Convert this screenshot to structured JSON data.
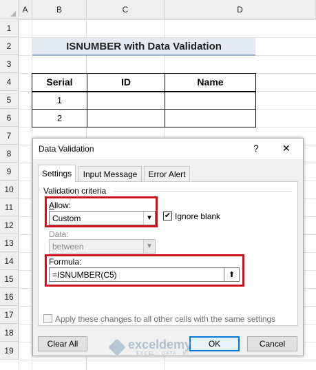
{
  "columns": [
    "A",
    "B",
    "C",
    "D"
  ],
  "rows": [
    "1",
    "2",
    "3",
    "4",
    "5",
    "6",
    "7",
    "8",
    "9",
    "10",
    "11",
    "12",
    "13",
    "14",
    "15",
    "16",
    "17",
    "18",
    "19"
  ],
  "sheet_title": "ISNUMBER with Data Validation",
  "table": {
    "headers": [
      "Serial",
      "ID",
      "Name"
    ],
    "rows": [
      [
        "1",
        "",
        ""
      ],
      [
        "2",
        "",
        ""
      ]
    ]
  },
  "dialog": {
    "title": "Data Validation",
    "help": "?",
    "close": "✕",
    "tabs": [
      "Settings",
      "Input Message",
      "Error Alert"
    ],
    "criteria_label": "Validation criteria",
    "allow_label": "Allow:",
    "allow_value": "Custom",
    "ignore_blank_label": "Ignore blank",
    "ignore_blank_checked": true,
    "data_label": "Data:",
    "data_value": "between",
    "formula_label": "Formula:",
    "formula_value": "=ISNUMBER(C5)",
    "apply_all_label": "Apply these changes to all other cells with the same settings",
    "clear_all": "Clear All",
    "ok": "OK",
    "cancel": "Cancel"
  },
  "watermark": {
    "name": "exceldemy",
    "tagline": "EXCEL · DATA · BI"
  },
  "colors": {
    "highlight_red": "#d0111b",
    "title_fill": "#e5e9f3",
    "ok_border": "#0078d7"
  }
}
